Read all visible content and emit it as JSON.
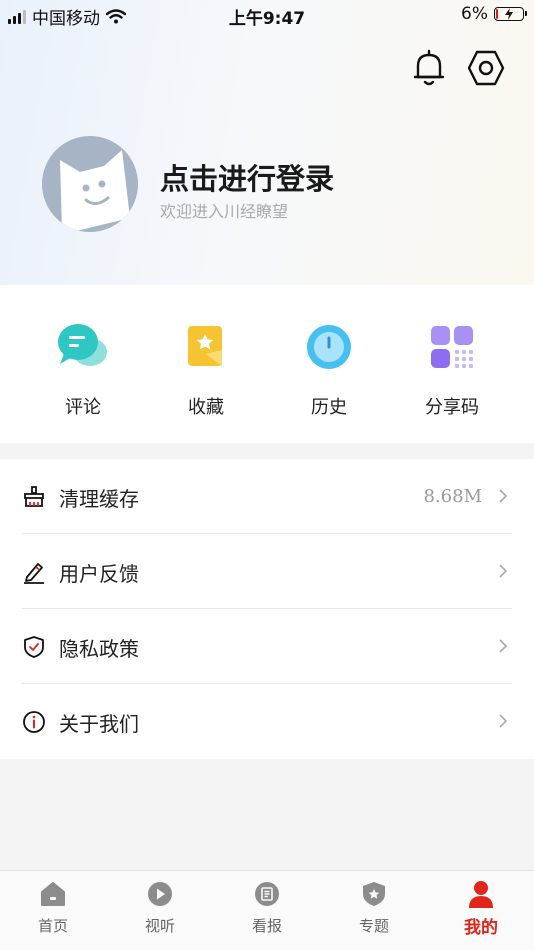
{
  "status_bar": {
    "carrier": "中国移动",
    "time": "上午9:47",
    "battery": "6%"
  },
  "header": {
    "login_title": "点击进行登录",
    "login_subtitle": "欢迎进入川经瞭望",
    "icons": [
      "bell-icon",
      "settings-icon"
    ]
  },
  "quick_actions": [
    {
      "label": "评论",
      "icon": "comment-icon"
    },
    {
      "label": "收藏",
      "icon": "favorite-icon"
    },
    {
      "label": "历史",
      "icon": "history-icon"
    },
    {
      "label": "分享码",
      "icon": "share-code-icon"
    }
  ],
  "menu": [
    {
      "label": "清理缓存",
      "value": "8.68M",
      "icon": "broom-icon"
    },
    {
      "label": "用户反馈",
      "value": "",
      "icon": "pencil-icon"
    },
    {
      "label": "隐私政策",
      "value": "",
      "icon": "shield-icon"
    },
    {
      "label": "关于我们",
      "value": "",
      "icon": "info-icon"
    }
  ],
  "tabbar": [
    {
      "label": "首页",
      "icon": "home-icon",
      "active": false
    },
    {
      "label": "视听",
      "icon": "play-icon",
      "active": false
    },
    {
      "label": "看报",
      "icon": "newspaper-icon",
      "active": false
    },
    {
      "label": "专题",
      "icon": "topic-icon",
      "active": false
    },
    {
      "label": "我的",
      "icon": "user-icon",
      "active": true
    }
  ],
  "colors": {
    "accent": "#e0251b",
    "teal": "#2fc7c3",
    "gold": "#f5c430",
    "blue": "#45c0f0",
    "purple": "#8e6ef0"
  }
}
